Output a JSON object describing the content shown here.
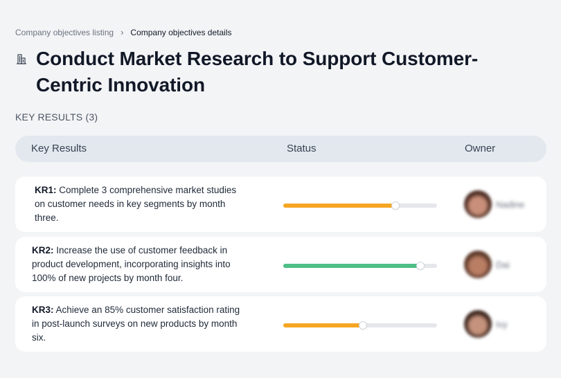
{
  "breadcrumb": {
    "parent": "Company objectives listing",
    "separator": "›",
    "current": "Company objectives details"
  },
  "objective": {
    "icon": "building-icon",
    "title": "Conduct Market Research to Support Customer-Centric Innovation"
  },
  "key_results_label": "KEY RESULTS (3)",
  "table": {
    "headers": {
      "key_results": "Key Results",
      "status": "Status",
      "owner": "Owner"
    },
    "rows": [
      {
        "code": "KR1:",
        "text": "Complete 3 comprehensive market studies on customer needs in key segments by month three.",
        "progress": 0.73,
        "progress_color": "#f5a623",
        "owner_name": "Nadine",
        "avatar_colors": [
          "#4a2a20",
          "#c98f7a"
        ]
      },
      {
        "code": "KR2:",
        "text": "Increase the use of customer feedback in product development, incorporating insights into 100% of new projects by month four.",
        "progress": 0.89,
        "progress_color": "#4fbf87",
        "owner_name": "Dai",
        "avatar_colors": [
          "#5a3526",
          "#b97e64"
        ]
      },
      {
        "code": "KR3:",
        "text": "Achieve an 85% customer satisfaction rating in post-launch surveys on new products by month six.",
        "progress": 0.52,
        "progress_color": "#f5a623",
        "owner_name": "Ivy",
        "avatar_colors": [
          "#3b241c",
          "#c5927c"
        ]
      }
    ]
  }
}
